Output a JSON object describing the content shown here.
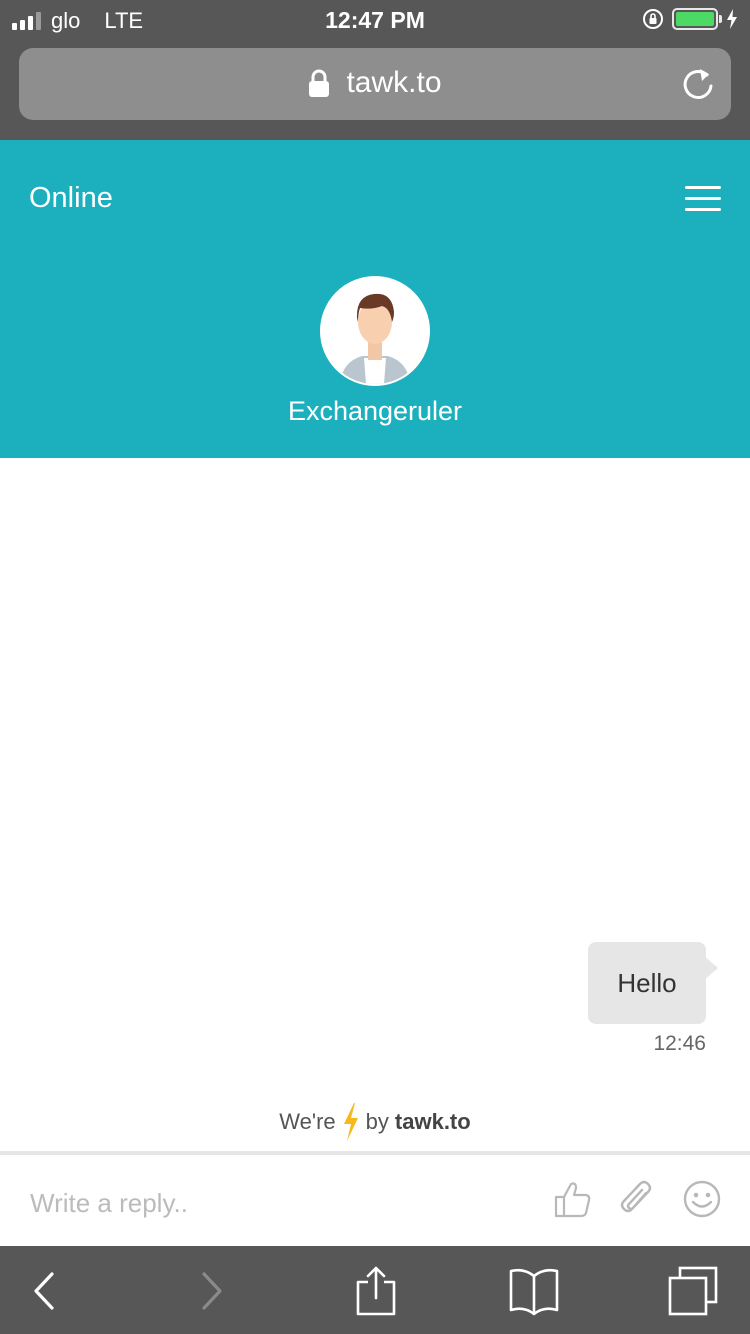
{
  "status_bar": {
    "carrier": "glo",
    "network": "LTE",
    "time": "12:47 PM",
    "battery_level": 1.0,
    "signal_bars": 3,
    "signal_bars_total": 4
  },
  "browser": {
    "url": "tawk.to"
  },
  "chat_header": {
    "status": "Online",
    "agent_name": "Exchangeruler",
    "background_color": "#1cb0bf"
  },
  "messages": [
    {
      "text": "Hello",
      "time": "12:46",
      "sender": "visitor"
    }
  ],
  "branding": {
    "prefix": "We're",
    "suffix": "by",
    "brand": "tawk.to"
  },
  "reply": {
    "placeholder": "Write a reply.."
  },
  "icons": {
    "menu": "hamburger-menu-icon",
    "thumb": "thumbs-up-icon",
    "attach": "paperclip-icon",
    "emoji": "smiley-icon",
    "back": "chevron-left-icon",
    "forward": "chevron-right-icon",
    "share": "share-icon",
    "bookmarks": "book-icon",
    "tabs": "tabs-icon"
  }
}
